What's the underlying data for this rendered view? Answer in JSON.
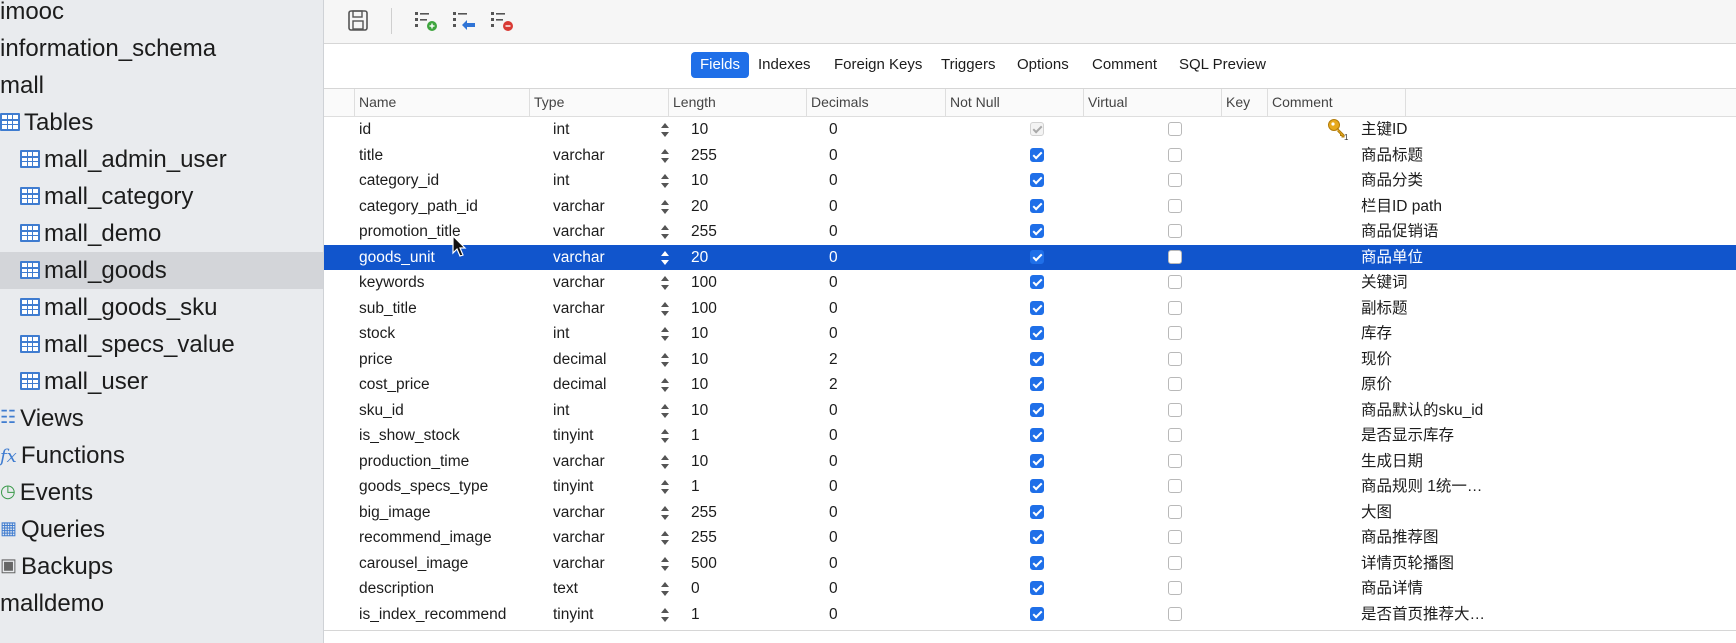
{
  "sidebar": {
    "items": [
      {
        "label": "imooc",
        "icon": "none",
        "indent": 0,
        "selected": false
      },
      {
        "label": "information_schema",
        "icon": "none",
        "indent": 0,
        "selected": false
      },
      {
        "label": "mall",
        "icon": "none",
        "indent": 0,
        "selected": false
      },
      {
        "label": "Tables",
        "icon": "table-icon",
        "indent": 1,
        "selected": false
      },
      {
        "label": "mall_admin_user",
        "icon": "table-icon",
        "indent": 2,
        "selected": false
      },
      {
        "label": "mall_category",
        "icon": "table-icon",
        "indent": 2,
        "selected": false
      },
      {
        "label": "mall_demo",
        "icon": "table-icon",
        "indent": 2,
        "selected": false
      },
      {
        "label": "mall_goods",
        "icon": "table-icon",
        "indent": 2,
        "selected": true
      },
      {
        "label": "mall_goods_sku",
        "icon": "table-icon",
        "indent": 2,
        "selected": false
      },
      {
        "label": "mall_specs_value",
        "icon": "table-icon",
        "indent": 2,
        "selected": false
      },
      {
        "label": "mall_user",
        "icon": "table-icon",
        "indent": 2,
        "selected": false
      },
      {
        "label": "Views",
        "icon": "views-icon",
        "indent": 1,
        "selected": false
      },
      {
        "label": "Functions",
        "icon": "functions-icon",
        "indent": 1,
        "selected": false
      },
      {
        "label": "Events",
        "icon": "events-icon",
        "indent": 1,
        "selected": false
      },
      {
        "label": "Queries",
        "icon": "queries-icon",
        "indent": 1,
        "selected": false
      },
      {
        "label": "Backups",
        "icon": "backups-icon",
        "indent": 1,
        "selected": false
      },
      {
        "label": "malldemo",
        "icon": "none",
        "indent": 0,
        "selected": false
      }
    ]
  },
  "toolbar": {
    "buttons": [
      "save-icon",
      "add-field-icon",
      "insert-field-icon",
      "delete-field-icon"
    ]
  },
  "tabs": {
    "items": [
      {
        "label": "Fields",
        "active": true
      },
      {
        "label": "Indexes",
        "active": false
      },
      {
        "label": "Foreign Keys",
        "active": false
      },
      {
        "label": "Triggers",
        "active": false
      },
      {
        "label": "Options",
        "active": false
      },
      {
        "label": "Comment",
        "active": false
      },
      {
        "label": "SQL Preview",
        "active": false
      }
    ]
  },
  "grid": {
    "headers": {
      "name": "Name",
      "type": "Type",
      "length": "Length",
      "decimals": "Decimals",
      "not_null": "Not Null",
      "virtual": "Virtual",
      "key": "Key",
      "comment": "Comment"
    },
    "selected_index": 5,
    "rows": [
      {
        "name": "id",
        "type": "int",
        "length": "10",
        "decimals": "0",
        "not_null": true,
        "not_null_disabled": true,
        "virtual": false,
        "key": true,
        "comment": "主键ID"
      },
      {
        "name": "title",
        "type": "varchar",
        "length": "255",
        "decimals": "0",
        "not_null": true,
        "virtual": false,
        "key": false,
        "comment": "商品标题"
      },
      {
        "name": "category_id",
        "type": "int",
        "length": "10",
        "decimals": "0",
        "not_null": true,
        "virtual": false,
        "key": false,
        "comment": "商品分类"
      },
      {
        "name": "category_path_id",
        "type": "varchar",
        "length": "20",
        "decimals": "0",
        "not_null": true,
        "virtual": false,
        "key": false,
        "comment": "栏目ID path"
      },
      {
        "name": "promotion_title",
        "type": "varchar",
        "length": "255",
        "decimals": "0",
        "not_null": true,
        "virtual": false,
        "key": false,
        "comment": "商品促销语"
      },
      {
        "name": "goods_unit",
        "type": "varchar",
        "length": "20",
        "decimals": "0",
        "not_null": true,
        "virtual": false,
        "key": false,
        "comment": "商品单位"
      },
      {
        "name": "keywords",
        "type": "varchar",
        "length": "100",
        "decimals": "0",
        "not_null": true,
        "virtual": false,
        "key": false,
        "comment": "关键词"
      },
      {
        "name": "sub_title",
        "type": "varchar",
        "length": "100",
        "decimals": "0",
        "not_null": true,
        "virtual": false,
        "key": false,
        "comment": "副标题"
      },
      {
        "name": "stock",
        "type": "int",
        "length": "10",
        "decimals": "0",
        "not_null": true,
        "virtual": false,
        "key": false,
        "comment": "库存"
      },
      {
        "name": "price",
        "type": "decimal",
        "length": "10",
        "decimals": "2",
        "not_null": true,
        "virtual": false,
        "key": false,
        "comment": "现价"
      },
      {
        "name": "cost_price",
        "type": "decimal",
        "length": "10",
        "decimals": "2",
        "not_null": true,
        "virtual": false,
        "key": false,
        "comment": "原价"
      },
      {
        "name": "sku_id",
        "type": "int",
        "length": "10",
        "decimals": "0",
        "not_null": true,
        "virtual": false,
        "key": false,
        "comment": "商品默认的sku_id"
      },
      {
        "name": "is_show_stock",
        "type": "tinyint",
        "length": "1",
        "decimals": "0",
        "not_null": true,
        "virtual": false,
        "key": false,
        "comment": "是否显示库存"
      },
      {
        "name": "production_time",
        "type": "varchar",
        "length": "10",
        "decimals": "0",
        "not_null": true,
        "virtual": false,
        "key": false,
        "comment": "生成日期"
      },
      {
        "name": "goods_specs_type",
        "type": "tinyint",
        "length": "1",
        "decimals": "0",
        "not_null": true,
        "virtual": false,
        "key": false,
        "comment": "商品规则 1统一…"
      },
      {
        "name": "big_image",
        "type": "varchar",
        "length": "255",
        "decimals": "0",
        "not_null": true,
        "virtual": false,
        "key": false,
        "comment": "大图"
      },
      {
        "name": "recommend_image",
        "type": "varchar",
        "length": "255",
        "decimals": "0",
        "not_null": true,
        "virtual": false,
        "key": false,
        "comment": "商品推荐图"
      },
      {
        "name": "carousel_image",
        "type": "varchar",
        "length": "500",
        "decimals": "0",
        "not_null": true,
        "virtual": false,
        "key": false,
        "comment": "详情页轮播图"
      },
      {
        "name": "description",
        "type": "text",
        "length": "0",
        "decimals": "0",
        "not_null": true,
        "virtual": false,
        "key": false,
        "comment": "商品详情"
      },
      {
        "name": "is_index_recommend",
        "type": "tinyint",
        "length": "1",
        "decimals": "0",
        "not_null": true,
        "virtual": false,
        "key": false,
        "comment": "是否首页推荐大…"
      }
    ]
  },
  "colors": {
    "accent": "#1f6fe8",
    "selection": "#1155cc",
    "sidebar_bg": "#e9ebee",
    "table_icon": "#3f7cd0"
  }
}
